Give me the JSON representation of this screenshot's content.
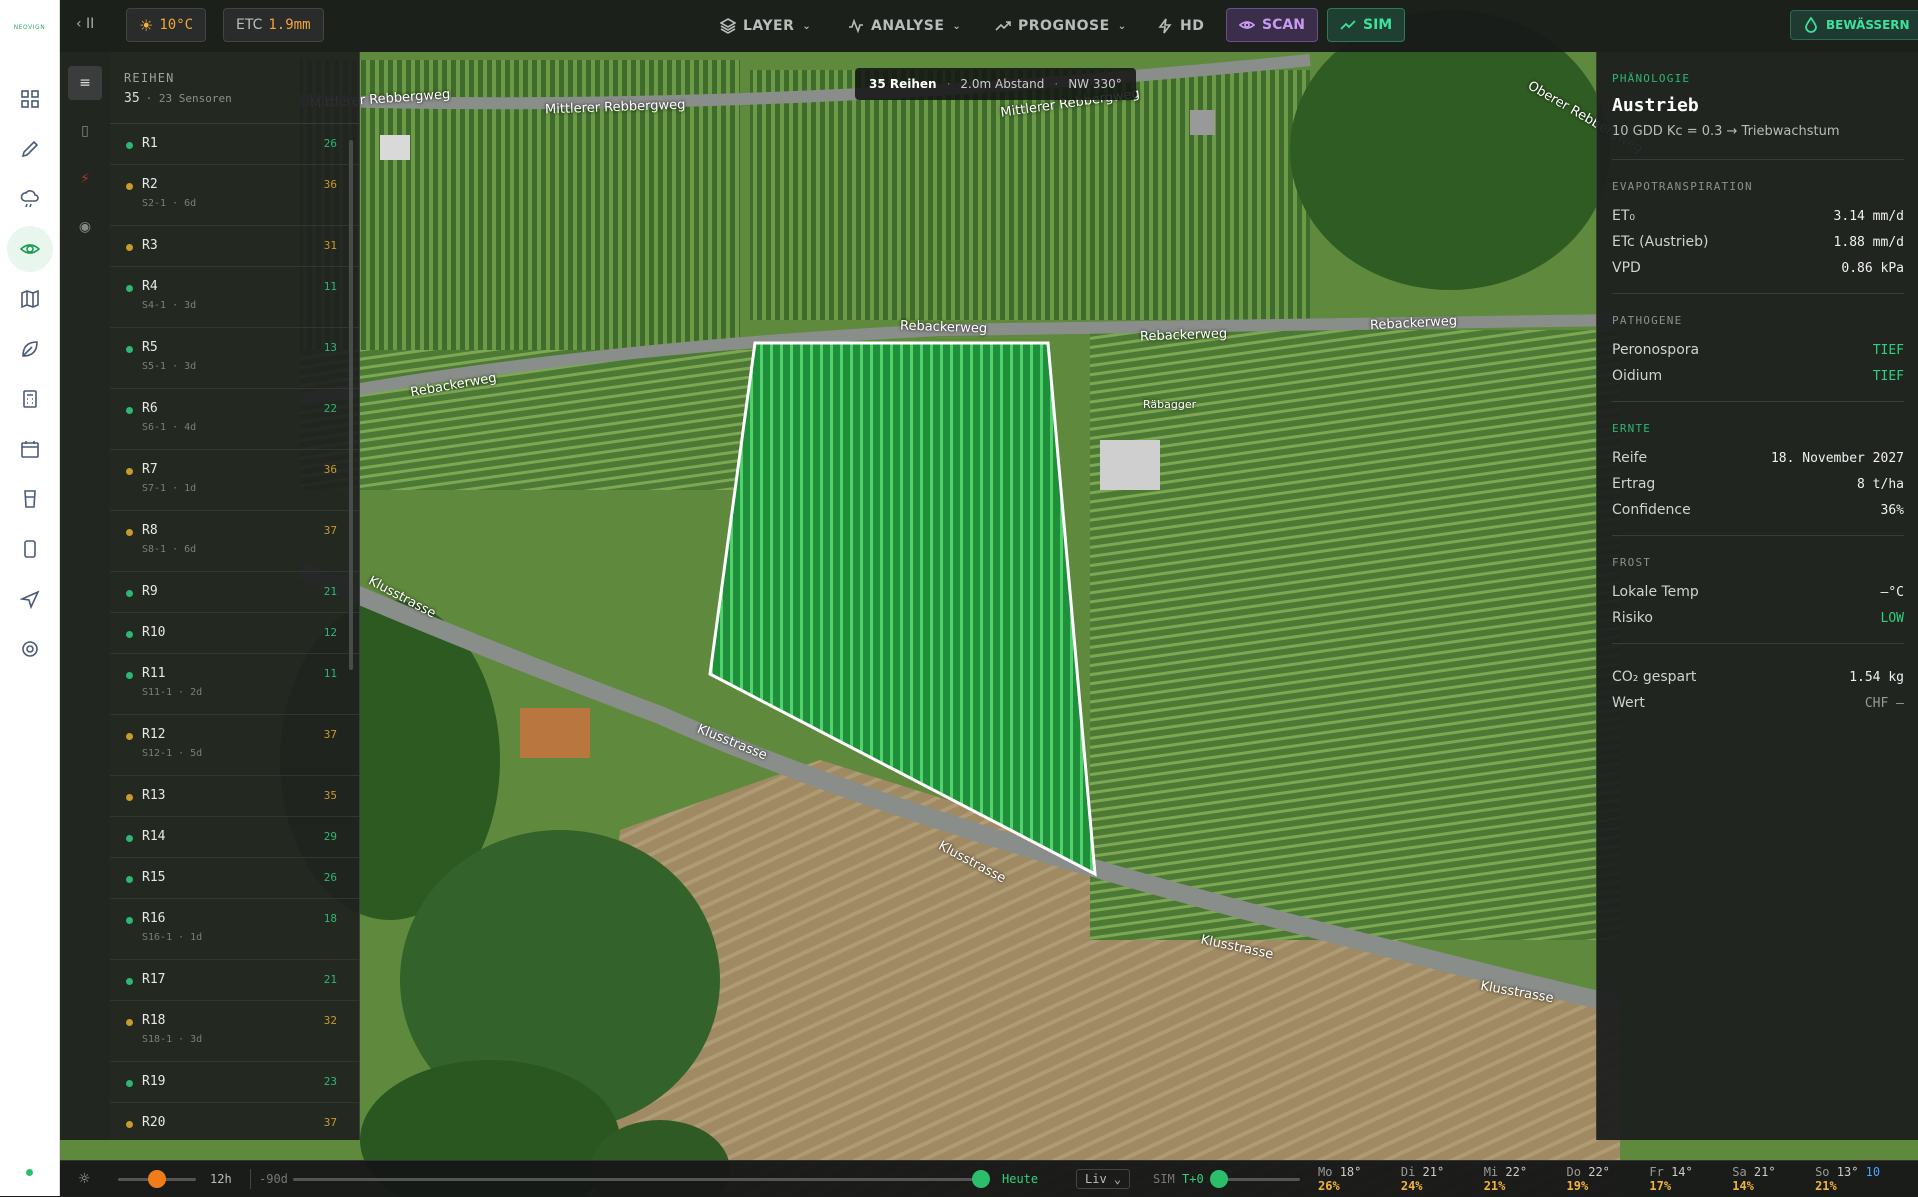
{
  "app": {
    "logo": "NEOVIGN"
  },
  "topbar": {
    "temp": "10°C",
    "etc_label": "ETC",
    "etc_value": "1.9mm",
    "nav": [
      {
        "label": "LAYER"
      },
      {
        "label": "ANALYSE"
      },
      {
        "label": "PROGNOSE"
      },
      {
        "label": "HD"
      }
    ],
    "scan_label": "SCAN",
    "sim_label": "SIM",
    "irrigate_label": "BEWÄSSERN"
  },
  "rows_panel": {
    "title": "REIHEN",
    "count": "35",
    "sensors": "· 23 Sensoren",
    "rows": [
      {
        "name": "R1",
        "count": "26",
        "sub": "",
        "status": "green"
      },
      {
        "name": "R2",
        "count": "36",
        "sub": "S2-1 · 6d",
        "status": "amber"
      },
      {
        "name": "R3",
        "count": "31",
        "sub": "",
        "status": "amber"
      },
      {
        "name": "R4",
        "count": "11",
        "sub": "S4-1 · 3d",
        "status": "green"
      },
      {
        "name": "R5",
        "count": "13",
        "sub": "S5-1 · 3d",
        "status": "green"
      },
      {
        "name": "R6",
        "count": "22",
        "sub": "S6-1 · 4d",
        "status": "green"
      },
      {
        "name": "R7",
        "count": "36",
        "sub": "S7-1 · 1d",
        "status": "amber"
      },
      {
        "name": "R8",
        "count": "37",
        "sub": "S8-1 · 6d",
        "status": "amber"
      },
      {
        "name": "R9",
        "count": "21",
        "sub": "",
        "status": "green"
      },
      {
        "name": "R10",
        "count": "12",
        "sub": "",
        "status": "green"
      },
      {
        "name": "R11",
        "count": "11",
        "sub": "S11-1 · 2d",
        "status": "green"
      },
      {
        "name": "R12",
        "count": "37",
        "sub": "S12-1 · 5d",
        "status": "amber"
      },
      {
        "name": "R13",
        "count": "35",
        "sub": "",
        "status": "amber"
      },
      {
        "name": "R14",
        "count": "29",
        "sub": "",
        "status": "green"
      },
      {
        "name": "R15",
        "count": "26",
        "sub": "",
        "status": "green"
      },
      {
        "name": "R16",
        "count": "18",
        "sub": "S16-1 · 1d",
        "status": "green"
      },
      {
        "name": "R17",
        "count": "21",
        "sub": "",
        "status": "green"
      },
      {
        "name": "R18",
        "count": "32",
        "sub": "S18-1 · 3d",
        "status": "amber"
      },
      {
        "name": "R19",
        "count": "23",
        "sub": "",
        "status": "green"
      },
      {
        "name": "R20",
        "count": "37",
        "sub": "",
        "status": "amber"
      }
    ]
  },
  "map_info": {
    "rows": "35 Reihen",
    "spacing": "2.0m Abstand",
    "orientation": "NW 330°"
  },
  "map_labels": {
    "mittlerer": "Mittlerer Rebbergweg",
    "rebacker": "Rebackerweg",
    "klusstrasse": "Klusstrasse",
    "rabagger": "Räbagger",
    "oberer": "Oberer Rebbergweg"
  },
  "right_panel": {
    "phenology_label": "PHÄNOLOGIE",
    "phase": "Austrieb",
    "phase_desc": "10 GDD Kc = 0.3 → Triebwachstum",
    "evapo_label": "EVAPOTRANSPIRATION",
    "et0_label": "ET₀",
    "et0_value": "3.14 mm/d",
    "etc_label": "ETc (Austrieb)",
    "etc_value": "1.88 mm/d",
    "vpd_label": "VPD",
    "vpd_value": "0.86 kPa",
    "pathogen_label": "PATHOGENE",
    "perono_label": "Peronospora",
    "perono_value": "TIEF",
    "oidium_label": "Oidium",
    "oidium_value": "TIEF",
    "harvest_label": "ERNTE",
    "reife_label": "Reife",
    "reife_value": "18. November 2027",
    "ertrag_label": "Ertrag",
    "ertrag_value": "8 t/ha",
    "conf_label": "Confidence",
    "conf_value": "36%",
    "frost_label": "FROST",
    "temp_label": "Lokale Temp",
    "temp_value": "—°C",
    "risk_label": "Risiko",
    "risk_value": "LOW",
    "co2_label": "CO₂ gespart",
    "co2_value": "1.54 kg",
    "wert_label": "Wert",
    "wert_value": "CHF —"
  },
  "bottom": {
    "hours": "12h",
    "range": "-90d",
    "today": "Heute",
    "mode": "Liv",
    "sim_label": "SIM",
    "sim_value": "T+0",
    "forecast": [
      {
        "day": "Mo",
        "temp": "18°",
        "pct": "26%"
      },
      {
        "day": "Di",
        "temp": "21°",
        "pct": "24%"
      },
      {
        "day": "Mi",
        "temp": "22°",
        "pct": "21%"
      },
      {
        "day": "Do",
        "temp": "22°",
        "pct": "19%"
      },
      {
        "day": "Fr",
        "temp": "14°",
        "pct": "17%"
      },
      {
        "day": "Sa",
        "temp": "21°",
        "pct": "14%"
      },
      {
        "day": "So",
        "temp": "13°",
        "extra": "10",
        "pct": "21%"
      }
    ]
  },
  "colors": {
    "green": "#2fb673",
    "amber": "#c99a2e",
    "accent": "#1d9a55"
  }
}
